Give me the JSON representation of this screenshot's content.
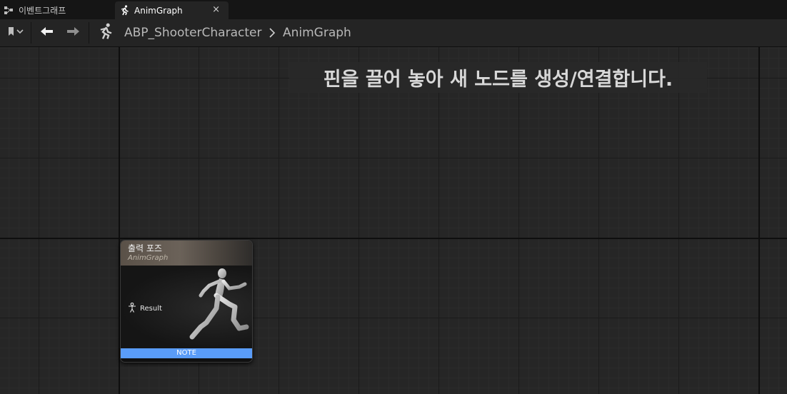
{
  "tabs": [
    {
      "label": "이벤트그래프",
      "icon": "event-graph-icon",
      "active": false
    },
    {
      "label": "AnimGraph",
      "icon": "running-man-icon",
      "active": true,
      "close": "×"
    }
  ],
  "toolbar": {
    "bookmark_icon": "bookmark-icon",
    "back_icon": "arrow-left-icon",
    "forward_icon": "arrow-right-icon",
    "graph_icon": "running-man-icon",
    "breadcrumb": {
      "asset": "ABP_ShooterCharacter",
      "separator_icon": "chevron-right-icon",
      "graph": "AnimGraph"
    }
  },
  "canvas": {
    "hint": "핀을 끌어 놓아 새 노드를 생성/연결합니다."
  },
  "node": {
    "title": "출력 포즈",
    "subtitle": "AnimGraph",
    "pin_label": "Result",
    "pin_icon": "pose-pin-icon",
    "preview_icon": "mannequin-running-icon",
    "footer": "NOTE"
  },
  "colors": {
    "footer": "#5a9cf8",
    "canvas_bg": "#262626",
    "toolbar_bg": "#242424"
  }
}
